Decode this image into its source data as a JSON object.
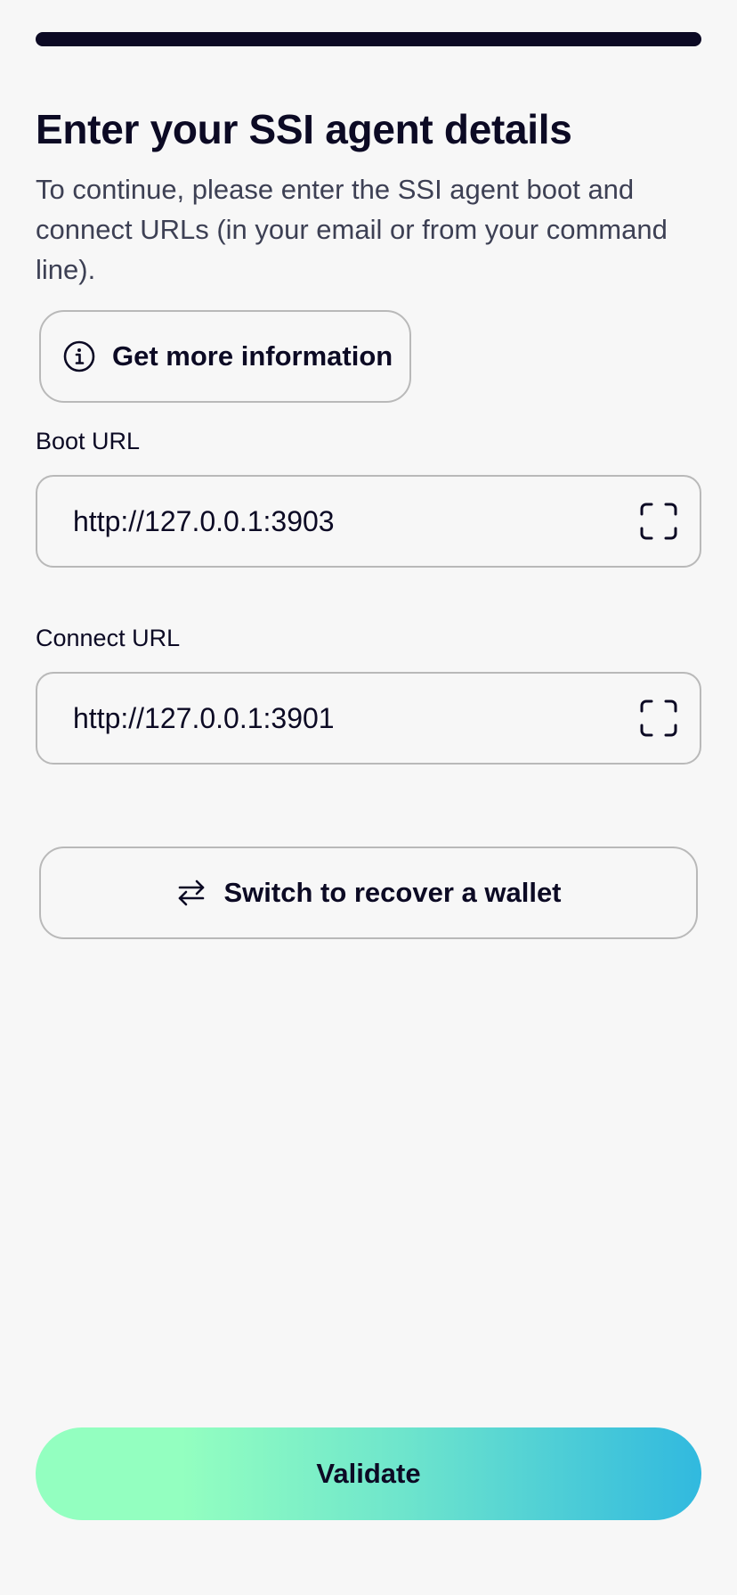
{
  "header": {
    "title": "Enter your SSI agent details",
    "subtitle": "To continue, please enter the SSI agent boot and connect URLs (in your email or from your command line)."
  },
  "info_button": {
    "label": "Get more information",
    "icon": "info-circle-icon"
  },
  "boot_url": {
    "label": "Boot URL",
    "value": "http://127.0.0.1:3903",
    "icon": "scan-frame-icon"
  },
  "connect_url": {
    "label": "Connect URL",
    "value": "http://127.0.0.1:3901",
    "icon": "scan-frame-icon"
  },
  "switch_button": {
    "label": "Switch to recover a wallet",
    "icon": "swap-arrows-icon"
  },
  "validate_button": {
    "label": "Validate"
  },
  "colors": {
    "text": "#0c0a24",
    "subtitle": "#3d4054",
    "border": "#b9b9b9",
    "background": "#f7f7f7",
    "gradient_start": "#93ffc0",
    "gradient_end": "#31b9df"
  }
}
